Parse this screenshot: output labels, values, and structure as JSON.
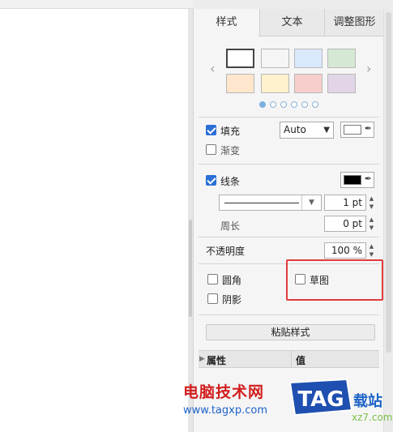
{
  "tabs": [
    {
      "label": "样式",
      "active": true
    },
    {
      "label": "文本",
      "active": false
    },
    {
      "label": "调整图形",
      "active": false
    }
  ],
  "swatches": {
    "row1": [
      "#ffffff",
      "#f5f5f5",
      "#dae8fc",
      "#d5e8d4"
    ],
    "row2": [
      "#ffe6cc",
      "#fff2cc",
      "#f8cecc",
      "#e1d5e7"
    ],
    "pages": 6,
    "current_page": 1
  },
  "fill": {
    "label": "填充",
    "checked": true,
    "mode": "Auto",
    "color": "#ffffff"
  },
  "gradient": {
    "label": "渐变",
    "checked": false
  },
  "line": {
    "label": "线条",
    "checked": true,
    "color": "#000000",
    "width": "1 pt"
  },
  "perimeter": {
    "label": "周长",
    "value": "0 pt"
  },
  "opacity": {
    "label": "不透明度",
    "value": "100 %"
  },
  "rounded": {
    "label": "圆角",
    "checked": false
  },
  "sketch": {
    "label": "草图",
    "checked": false
  },
  "shadow": {
    "label": "阴影",
    "checked": false
  },
  "paste_style": "粘贴样式",
  "properties": {
    "col1": "属性",
    "col2": "值"
  },
  "watermark": {
    "site_name": "电脑技术网",
    "site_url": "www.tagxp.com",
    "logo_text": "TAG",
    "suffix": "载站",
    "suffix_url": "xz7.com"
  }
}
